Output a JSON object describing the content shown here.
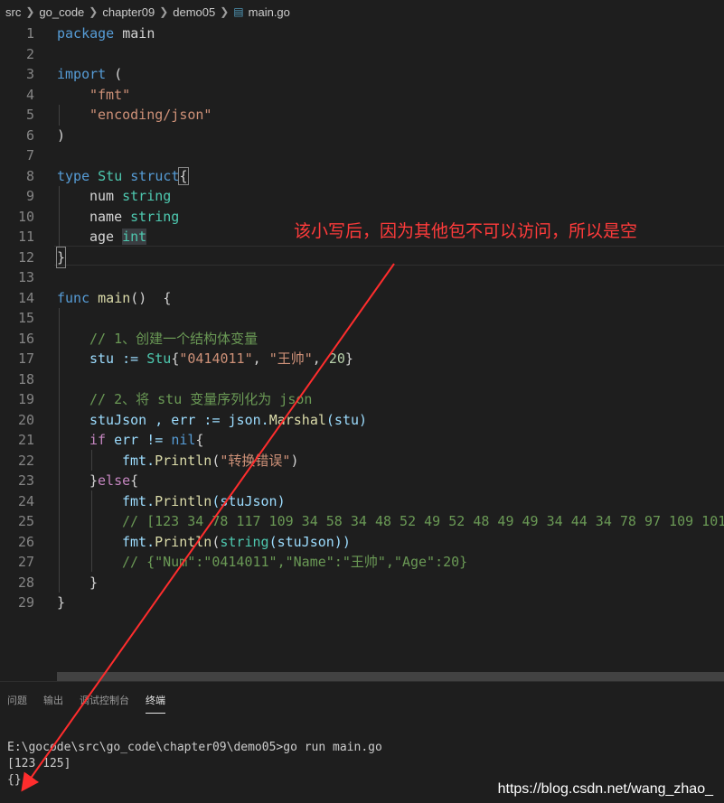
{
  "breadcrumb": {
    "items": [
      "src",
      "go_code",
      "chapter09",
      "demo05"
    ],
    "file": "main.go"
  },
  "line_numbers": [
    "1",
    "2",
    "3",
    "4",
    "5",
    "6",
    "7",
    "8",
    "9",
    "10",
    "11",
    "12",
    "13",
    "14",
    "15",
    "16",
    "17",
    "18",
    "19",
    "20",
    "21",
    "22",
    "23",
    "24",
    "25",
    "26",
    "27",
    "28",
    "29"
  ],
  "code": {
    "l1_kw": "package",
    "l1_name": " main",
    "l3_kw": "import",
    "l3_p": " (",
    "l4_s": "\"fmt\"",
    "l5_s": "\"encoding/json\"",
    "l6": ")",
    "l8_kw": "type",
    "l8_name": " Stu ",
    "l8_kw2": "struct",
    "l8_b": "{",
    "l9_f": "num ",
    "l9_t": "string",
    "l10_f": "name ",
    "l10_t": "string",
    "l11_f": "age ",
    "l11_t": "int",
    "l12": "}",
    "l14_kw": "func",
    "l14_fn": " main",
    "l14_r": "()  {",
    "l16_c": "// 1、创建一个结构体变量",
    "l17_a": "stu := ",
    "l17_t": "Stu",
    "l17_b": "{",
    "l17_s1": "\"0414011\"",
    "l17_comma": ", ",
    "l17_s2": "\"王帅\"",
    "l17_n": "20",
    "l17_e": "}",
    "l19_c": "// 2、将 stu 变量序列化为 json",
    "l20_a": "stuJson , err := json.",
    "l20_fn": "Marshal",
    "l20_e": "(stu)",
    "l21_kw": "if",
    "l21_a": " err != ",
    "l21_kw2": "nil",
    "l21_e": "{",
    "l22_a": "fmt.",
    "l22_fn": "Println",
    "l22_b": "(",
    "l22_s": "\"转换错误\"",
    "l22_e": ")",
    "l23_a": "}",
    "l23_kw": "else",
    "l23_e": "{",
    "l24_a": "fmt.",
    "l24_fn": "Println",
    "l24_e": "(stuJson)",
    "l25_c": "// [123 34 78 117 109 34 58 34 48 52 49 52 48 49 49 34 44 34 78 97 109 101",
    "l26_a": "fmt.",
    "l26_fn": "Println",
    "l26_b": "(",
    "l26_fn2": "string",
    "l26_e": "(stuJson))",
    "l27_c": "// {\"Num\":\"0414011\",\"Name\":\"王帅\",\"Age\":20}",
    "l28": "}",
    "l29": "}"
  },
  "annotation": "该小写后，因为其他包不可以访问，所以是空",
  "panel": {
    "tabs": [
      "问题",
      "输出",
      "调试控制台",
      "终端"
    ],
    "active_tab": "终端"
  },
  "terminal": {
    "prompt": "E:\\gocode\\src\\go_code\\chapter09\\demo05>go run main.go",
    "line1": "[123 125]",
    "line2": "{}"
  },
  "watermark": "https://blog.csdn.net/wang_zhao_",
  "colors": {
    "background": "#1e1e1e",
    "keyword": "#569cd6",
    "type": "#4ec9b0",
    "string": "#ce9178",
    "comment": "#6a9955",
    "annotation": "#ff3b3b"
  },
  "icons": {
    "file": "go-file-icon",
    "separator": "chevron-right-icon"
  }
}
